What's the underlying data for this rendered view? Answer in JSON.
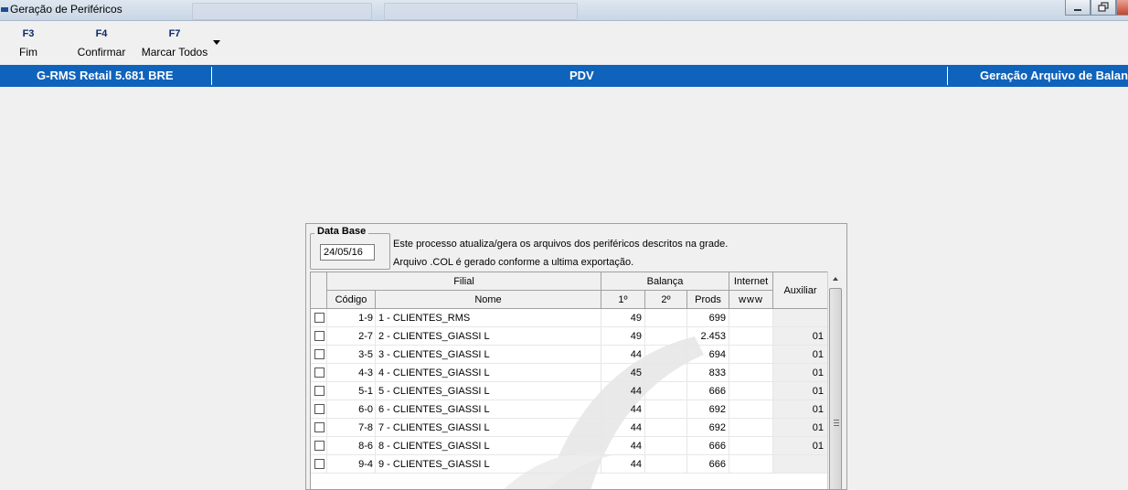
{
  "window": {
    "title": "Geração de Periféricos"
  },
  "toolbar": {
    "buttons": [
      {
        "key": "F3",
        "label": "Fim"
      },
      {
        "key": "F4",
        "label": "Confirmar"
      },
      {
        "key": "F7",
        "label": "Marcar Todos"
      }
    ]
  },
  "statusbar": {
    "left": "G-RMS Retail 5.681 BRE",
    "center": "PDV",
    "right": "Geração Arquivo de Balança"
  },
  "panel": {
    "data_base_label": "Data Base",
    "data_base_value": "24/05/16",
    "info_line1": "Este processo atualiza/gera os arquivos dos periféricos descritos na grade.",
    "info_line2": "Arquivo .COL é gerado conforme a ultima exportação."
  },
  "grid": {
    "group_headers": {
      "filial": "Filial",
      "balanca": "Balança",
      "internet": "Internet",
      "auxiliar": "Auxiliar"
    },
    "columns": {
      "codigo": "Código",
      "nome": "Nome",
      "b1": "1º",
      "b2": "2º",
      "prods": "Prods",
      "www": "www"
    },
    "rows": [
      {
        "codigo": "1-9",
        "nome": "1 - CLIENTES_RMS",
        "b1": "49",
        "b2": "",
        "prods": "699",
        "www": "",
        "aux": ""
      },
      {
        "codigo": "2-7",
        "nome": "2 - CLIENTES_GIASSI L",
        "b1": "49",
        "b2": "",
        "prods": "2.453",
        "www": "",
        "aux": "01"
      },
      {
        "codigo": "3-5",
        "nome": "3 - CLIENTES_GIASSI L",
        "b1": "44",
        "b2": "",
        "prods": "694",
        "www": "",
        "aux": "01"
      },
      {
        "codigo": "4-3",
        "nome": "4 - CLIENTES_GIASSI L",
        "b1": "45",
        "b2": "",
        "prods": "833",
        "www": "",
        "aux": "01"
      },
      {
        "codigo": "5-1",
        "nome": "5 - CLIENTES_GIASSI L",
        "b1": "44",
        "b2": "",
        "prods": "666",
        "www": "",
        "aux": "01"
      },
      {
        "codigo": "6-0",
        "nome": "6 - CLIENTES_GIASSI L",
        "b1": "44",
        "b2": "",
        "prods": "692",
        "www": "",
        "aux": "01"
      },
      {
        "codigo": "7-8",
        "nome": "7 - CLIENTES_GIASSI L",
        "b1": "44",
        "b2": "",
        "prods": "692",
        "www": "",
        "aux": "01"
      },
      {
        "codigo": "8-6",
        "nome": "8 - CLIENTES_GIASSI L",
        "b1": "44",
        "b2": "",
        "prods": "666",
        "www": "",
        "aux": "01"
      },
      {
        "codigo": "9-4",
        "nome": "9 - CLIENTES_GIASSI L",
        "b1": "44",
        "b2": "",
        "prods": "666",
        "www": "",
        "aux": ""
      }
    ]
  },
  "colors": {
    "statusbar_bg": "#0f63bb",
    "toolbar_key": "#0a2a6b"
  }
}
